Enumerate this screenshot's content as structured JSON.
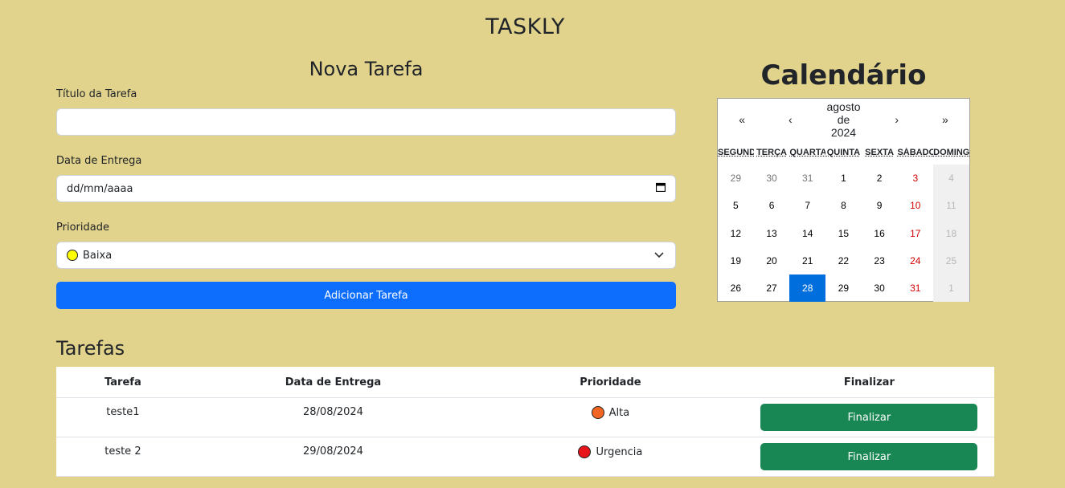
{
  "app": {
    "title": "TASKLY"
  },
  "form": {
    "title": "Nova Tarefa",
    "task_title_label": "Título da Tarefa",
    "task_title_value": "",
    "due_date_label": "Data de Entrega",
    "due_date_placeholder": "dd/mm/aaaa",
    "priority_label": "Prioridade",
    "priority_value": "Baixa",
    "priority_color": "#ffff00",
    "add_button_label": "Adicionar Tarefa"
  },
  "calendar": {
    "title": "Calendário",
    "nav": {
      "prev_year": "«",
      "prev_month": "‹",
      "month_label": [
        "agosto",
        "de",
        "2024"
      ],
      "next_month": "›",
      "next_year": "»"
    },
    "weekdays": [
      "SEGUNDA",
      "TERÇA",
      "QUARTA",
      "QUINTA",
      "SEXTA",
      "SÁBADO",
      "DOMINGO"
    ],
    "days": [
      {
        "d": "29",
        "cls": "neighbor"
      },
      {
        "d": "30",
        "cls": "neighbor"
      },
      {
        "d": "31",
        "cls": "neighbor"
      },
      {
        "d": "1",
        "cls": ""
      },
      {
        "d": "2",
        "cls": ""
      },
      {
        "d": "3",
        "cls": "weekend"
      },
      {
        "d": "4",
        "cls": "sunday"
      },
      {
        "d": "5",
        "cls": ""
      },
      {
        "d": "6",
        "cls": ""
      },
      {
        "d": "7",
        "cls": ""
      },
      {
        "d": "8",
        "cls": ""
      },
      {
        "d": "9",
        "cls": ""
      },
      {
        "d": "10",
        "cls": "weekend"
      },
      {
        "d": "11",
        "cls": "sunday"
      },
      {
        "d": "12",
        "cls": ""
      },
      {
        "d": "13",
        "cls": ""
      },
      {
        "d": "14",
        "cls": ""
      },
      {
        "d": "15",
        "cls": ""
      },
      {
        "d": "16",
        "cls": ""
      },
      {
        "d": "17",
        "cls": "weekend"
      },
      {
        "d": "18",
        "cls": "sunday"
      },
      {
        "d": "19",
        "cls": ""
      },
      {
        "d": "20",
        "cls": ""
      },
      {
        "d": "21",
        "cls": ""
      },
      {
        "d": "22",
        "cls": ""
      },
      {
        "d": "23",
        "cls": ""
      },
      {
        "d": "24",
        "cls": "weekend"
      },
      {
        "d": "25",
        "cls": "sunday"
      },
      {
        "d": "26",
        "cls": ""
      },
      {
        "d": "27",
        "cls": ""
      },
      {
        "d": "28",
        "cls": "today"
      },
      {
        "d": "29",
        "cls": ""
      },
      {
        "d": "30",
        "cls": ""
      },
      {
        "d": "31",
        "cls": "weekend"
      },
      {
        "d": "1",
        "cls": "sunday"
      }
    ]
  },
  "tasks": {
    "title": "Tarefas",
    "headers": {
      "task": "Tarefa",
      "due": "Data de Entrega",
      "priority": "Prioridade",
      "finish": "Finalizar"
    },
    "rows": [
      {
        "task": "teste1",
        "due": "28/08/2024",
        "priority": "Alta",
        "priority_color": "#f26522",
        "finish_label": "Finalizar"
      },
      {
        "task": "teste 2",
        "due": "29/08/2024",
        "priority": "Urgencia",
        "priority_color": "#e8141c",
        "finish_label": "Finalizar"
      }
    ]
  }
}
